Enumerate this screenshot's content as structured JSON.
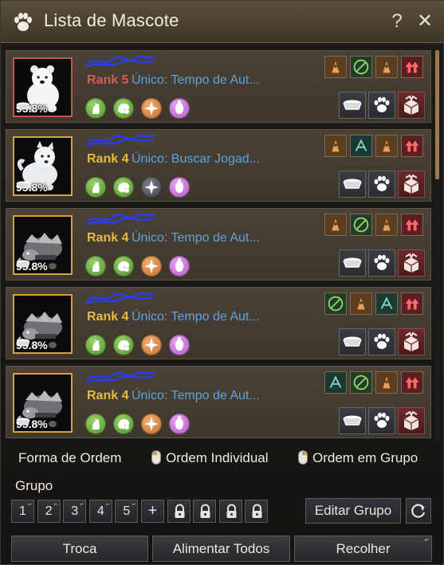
{
  "window": {
    "title": "Lista de Mascote",
    "help_label": "?",
    "close_label": "✕"
  },
  "pets": [
    {
      "rank": "Rank 5",
      "unique": "Único: Tempo de Aut...",
      "hunger": "95.8%",
      "portrait": "polar-bear",
      "skills": [
        "green",
        "green",
        "orange",
        "pink"
      ],
      "talents": [
        "brown",
        "green",
        "brown",
        "red"
      ]
    },
    {
      "rank": "Rank 4",
      "unique": "Único: Buscar Jogad...",
      "hunger": "95.8%",
      "portrait": "white-dog",
      "skills": [
        "green",
        "green",
        "gray",
        "pink"
      ],
      "talents": [
        "brown",
        "teal",
        "brown",
        "red"
      ]
    },
    {
      "rank": "Rank 4",
      "unique": "Único: Tempo de Aut...",
      "hunger": "95.8%",
      "portrait": "armored-beast",
      "skills": [
        "green",
        "green",
        "orange",
        "pink"
      ],
      "talents": [
        "brown",
        "green",
        "brown",
        "red"
      ]
    },
    {
      "rank": "Rank 4",
      "unique": "Único: Tempo de Aut...",
      "hunger": "95.8%",
      "portrait": "armored-beast",
      "skills": [
        "green",
        "green",
        "orange",
        "pink"
      ],
      "talents": [
        "green",
        "brown",
        "teal",
        "red"
      ]
    },
    {
      "rank": "Rank 4",
      "unique": "Único: Tempo de Aut...",
      "hunger": "95.8%",
      "portrait": "armored-beast",
      "skills": [
        "green",
        "green",
        "orange",
        "pink"
      ],
      "talents": [
        "teal",
        "green",
        "brown",
        "red"
      ]
    }
  ],
  "order": {
    "label": "Forma de Ordem",
    "individual": "Ordem Individual",
    "group": "Ordem em Grupo"
  },
  "group": {
    "label": "Grupo",
    "numbers": [
      "1",
      "2",
      "3",
      "4",
      "5"
    ],
    "add_label": "+",
    "edit_label": "Editar Grupo"
  },
  "bottom": {
    "trade": "Troca",
    "feed_all": "Alimentar Todos",
    "collect": "Recolher"
  },
  "colors": {
    "rank4": "#e8b93c",
    "rank5": "#d25c57",
    "unique": "#5aa3e0",
    "accent": "#9c7a4a"
  },
  "scroll": {
    "position": 0.0,
    "visible_fraction": 0.33
  }
}
